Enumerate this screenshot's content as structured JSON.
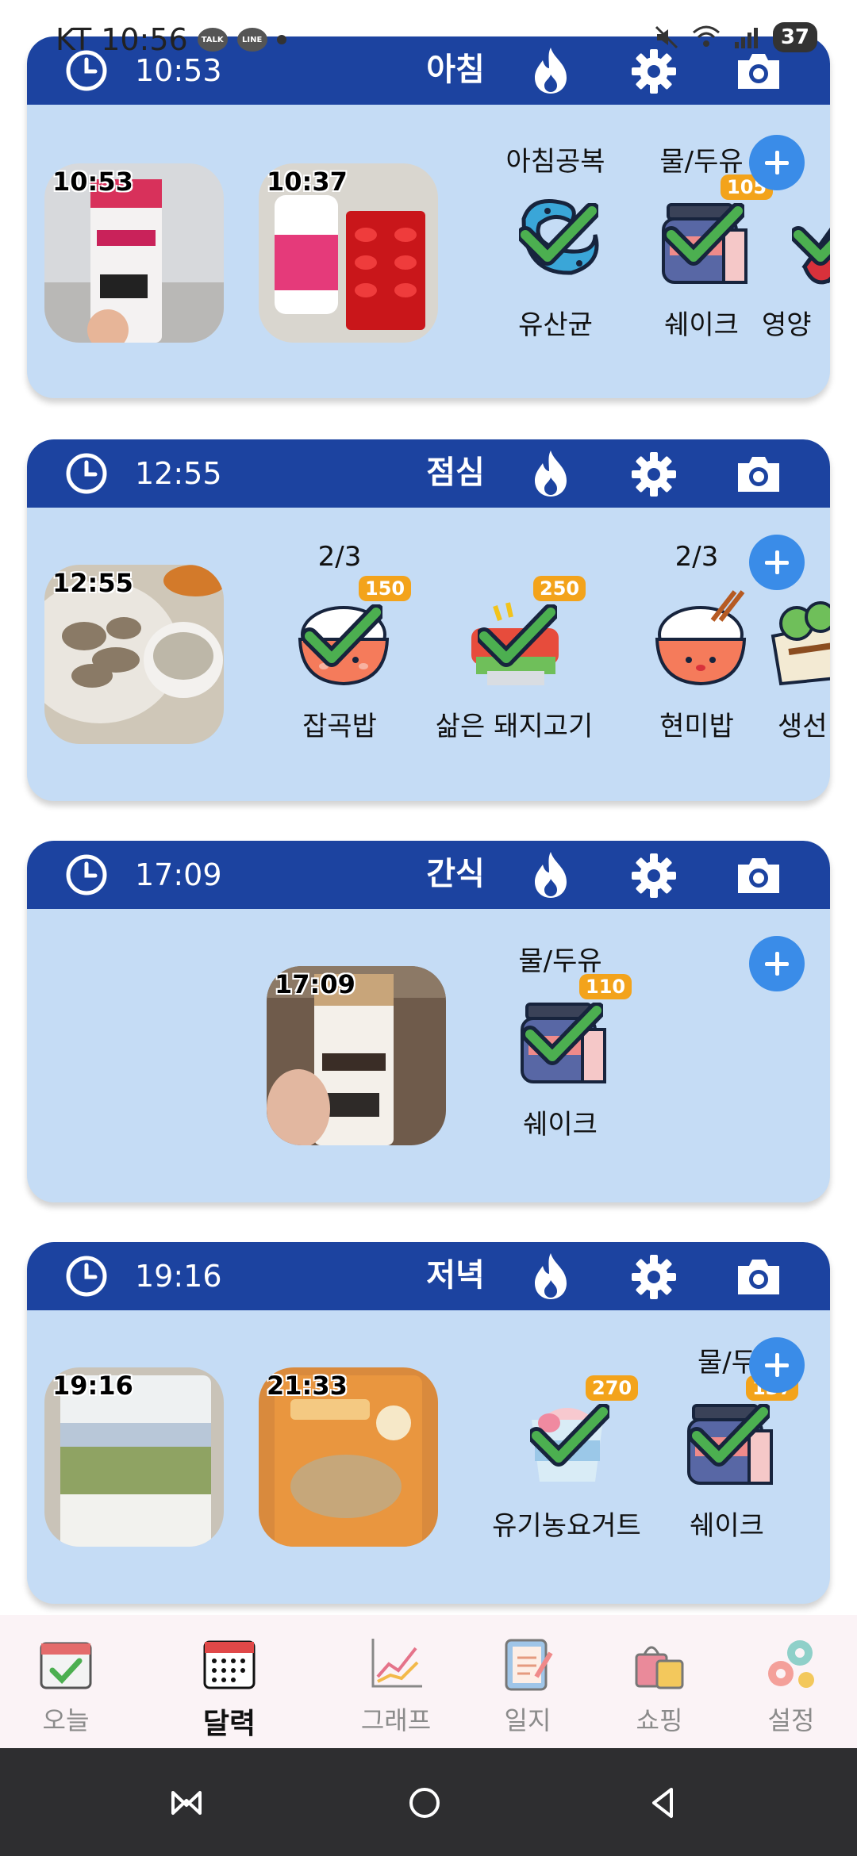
{
  "status_bar": {
    "carrier": "KT",
    "time": "10:56",
    "battery": "37",
    "bubbles": [
      "TALK",
      "LINE"
    ]
  },
  "meals": [
    {
      "time": "10:53",
      "title": "아침",
      "photos": [
        {
          "time": "10:53",
          "alt": "strawberry protein drink"
        },
        {
          "time": "10:37",
          "alt": "supplement pills"
        }
      ],
      "foods": [
        {
          "top": "아침공복",
          "name": "유산균",
          "icon": "probiotic-icon",
          "kcal": ""
        },
        {
          "top": "물/두유",
          "name": "쉐이크",
          "icon": "shake-jar-icon",
          "kcal": "105"
        },
        {
          "top": "",
          "name": "영양",
          "icon": "capsule-icon",
          "kcal": ""
        }
      ]
    },
    {
      "time": "12:55",
      "title": "점심",
      "photos": [
        {
          "time": "12:55",
          "alt": "boiled pork and rice"
        }
      ],
      "foods": [
        {
          "top": "2/3",
          "name": "잡곡밥",
          "icon": "rice-bowl-icon",
          "kcal": "150"
        },
        {
          "top": "",
          "name": "삶은 돼지고기",
          "icon": "pork-meat-icon",
          "kcal": "250"
        },
        {
          "top": "2/3",
          "name": "현미밥",
          "icon": "rice-bowl-icon",
          "kcal": ""
        },
        {
          "top": "",
          "name": "생선",
          "icon": "wrap-icon",
          "kcal": ""
        }
      ]
    },
    {
      "time": "17:09",
      "title": "간식",
      "photos": [
        {
          "time": "17:09",
          "alt": "coffee protein drink"
        }
      ],
      "foods": [
        {
          "top": "물/두유",
          "name": "쉐이크",
          "icon": "shake-jar-icon",
          "kcal": "110"
        }
      ]
    },
    {
      "time": "19:16",
      "title": "저녁",
      "photos": [
        {
          "time": "19:16",
          "alt": "organic yogurt cup"
        },
        {
          "time": "21:33",
          "alt": "misugaru powder pack"
        }
      ],
      "foods": [
        {
          "top": "",
          "name": "유기농요거트",
          "icon": "yogurt-icon",
          "kcal": "270"
        },
        {
          "top": "물/두",
          "name": "쉐이크",
          "icon": "shake-jar-icon",
          "kcal": "137"
        }
      ]
    }
  ],
  "nav": [
    {
      "label": "오늘",
      "icon": "calendar-check-icon",
      "active": false
    },
    {
      "label": "달력",
      "icon": "calendar-grid-icon",
      "active": true
    },
    {
      "label": "그래프",
      "icon": "chart-icon",
      "active": false
    },
    {
      "label": "일지",
      "icon": "journal-icon",
      "active": false
    },
    {
      "label": "쇼핑",
      "icon": "shopping-bag-icon",
      "active": false
    },
    {
      "label": "설정",
      "icon": "gears-icon",
      "active": false
    }
  ],
  "colors": {
    "header": "#1c43a0",
    "card": "#c5dcf5",
    "accent": "#3a8ce8",
    "kcal_badge": "#f3a31b",
    "check": "#4caf50"
  }
}
